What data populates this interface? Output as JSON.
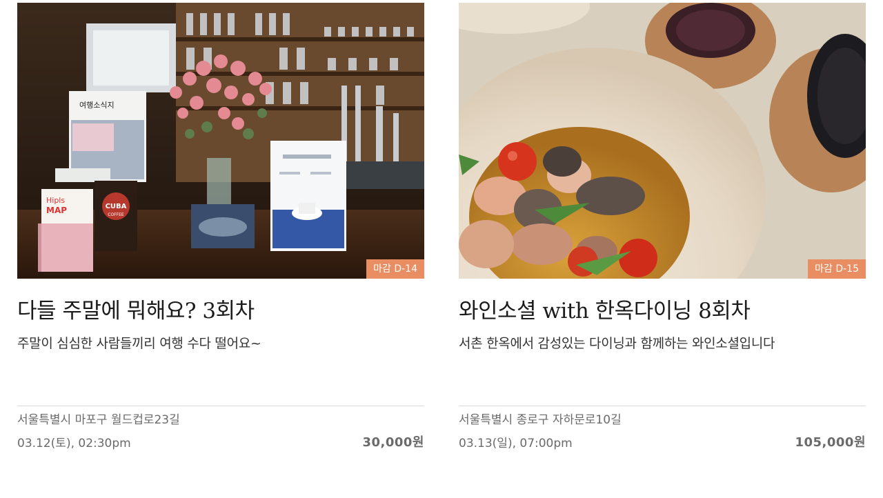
{
  "colors": {
    "badge_bg": "#e98d63",
    "divider": "#d8d8d8",
    "meta_text": "#6a6a6a"
  },
  "cards": [
    {
      "badge": "마감 D-14",
      "title": "다들 주말에 뭐해요? 3회차",
      "subtitle": "주말이 심심한 사람들끼리 여행 수다 떨어요~",
      "address": "서울특별시 마포구 월드컵로23길",
      "datetime": "03.12(토), 02:30pm",
      "price": "30,000원",
      "image_labels": {
        "book_small": "여행소식지",
        "map_label": "MAP",
        "map_brand": "Hipls",
        "coffee": "CUBA",
        "coffee_sub": "COFFEE"
      }
    },
    {
      "badge": "마감 D-15",
      "title": "와인소셜 with 한옥다이닝 8회차",
      "subtitle": "서촌 한옥에서 감성있는 다이닝과 함께하는 와인소셜입니다",
      "address": "서울특별시 종로구 자하문로10길",
      "datetime": "03.13(일), 07:00pm",
      "price": "105,000원"
    }
  ]
}
